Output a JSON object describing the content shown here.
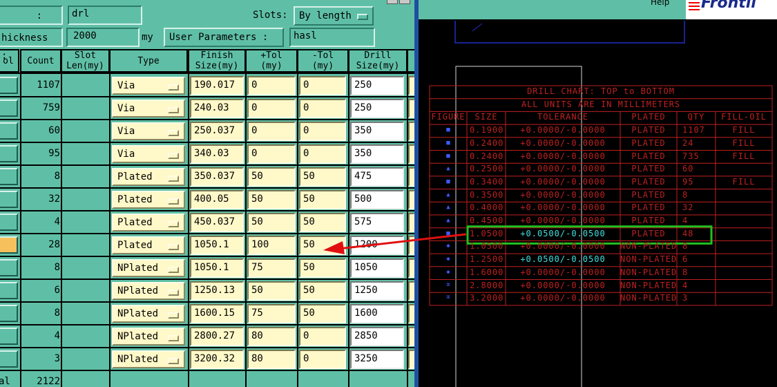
{
  "dialog": {
    "colon_label": ":",
    "name_value": "drl",
    "slots_label": "Slots:",
    "slots_value": "By length",
    "thickness_label": "hickness :",
    "thickness_value": "2000",
    "thickness_unit": "my",
    "user_params_label": "User Parameters :",
    "user_params_value": "hasl",
    "headers": [
      "ol",
      "Count",
      "Slot\nLen(my)",
      "Type",
      "Finish\nSize(my)",
      "+Tol\n(my)",
      "-Tol\n(my)",
      "Drill\nSize(my)"
    ],
    "rows": [
      {
        "count": "1107",
        "type": "Via",
        "finish": "190.017",
        "ptol": "0",
        "ntol": "0",
        "drill": "250"
      },
      {
        "count": "759",
        "type": "Via",
        "finish": "240.03",
        "ptol": "0",
        "ntol": "0",
        "drill": "250"
      },
      {
        "count": "60",
        "type": "Via",
        "finish": "250.037",
        "ptol": "0",
        "ntol": "0",
        "drill": "350"
      },
      {
        "count": "95",
        "type": "Via",
        "finish": "340.03",
        "ptol": "0",
        "ntol": "0",
        "drill": "350"
      },
      {
        "count": "8",
        "type": "Plated",
        "finish": "350.037",
        "ptol": "50",
        "ntol": "50",
        "drill": "475"
      },
      {
        "count": "32",
        "type": "Plated",
        "finish": "400.05",
        "ptol": "50",
        "ntol": "50",
        "drill": "500"
      },
      {
        "count": "4",
        "type": "Plated",
        "finish": "450.037",
        "ptol": "50",
        "ntol": "50",
        "drill": "575"
      },
      {
        "count": "28",
        "type": "Plated",
        "finish": "1050.1",
        "ptol": "100",
        "ntol": "50",
        "drill": "1200",
        "selected": true
      },
      {
        "count": "8",
        "type": "NPlated",
        "finish": "1050.1",
        "ptol": "75",
        "ntol": "50",
        "drill": "1050"
      },
      {
        "count": "6",
        "type": "NPlated",
        "finish": "1250.13",
        "ptol": "50",
        "ntol": "50",
        "drill": "1250"
      },
      {
        "count": "8",
        "type": "NPlated",
        "finish": "1600.15",
        "ptol": "75",
        "ntol": "50",
        "drill": "1600"
      },
      {
        "count": "4",
        "type": "NPlated",
        "finish": "2800.27",
        "ptol": "80",
        "ntol": "0",
        "drill": "2850"
      },
      {
        "count": "3",
        "type": "NPlated",
        "finish": "3200.32",
        "ptol": "80",
        "ntol": "0",
        "drill": "3250"
      }
    ],
    "total_label": "al",
    "total_count": "2122"
  },
  "cad": {
    "help_label": "Help",
    "logo_text": "Frontli",
    "chart_title": "DRILL CHART: TOP to BOTTOM",
    "chart_subtitle": "ALL UNITS ARE IN MILLIMETERS",
    "columns": [
      "FIGURE",
      "SIZE",
      "TOLERANCE",
      "PLATED",
      "QTY",
      "FILL-OIL"
    ],
    "rows": [
      {
        "size": "0.1900",
        "tol": "+0.0000/-0.0000",
        "plated": "PLATED",
        "qty": "1107",
        "fill": "FILL"
      },
      {
        "size": "0.2400",
        "tol": "+0.0000/-0.0000",
        "plated": "PLATED",
        "qty": "24",
        "fill": "FILL"
      },
      {
        "size": "0.2400",
        "tol": "+0.0000/-0.0000",
        "plated": "PLATED",
        "qty": "735",
        "fill": "FILL"
      },
      {
        "size": "0.2500",
        "tol": "+0.0000/-0.0000",
        "plated": "PLATED",
        "qty": "60",
        "fill": ""
      },
      {
        "size": "0.3400",
        "tol": "+0.0000/-0.0000",
        "plated": "PLATED",
        "qty": "95",
        "fill": "FILL"
      },
      {
        "size": "0.3500",
        "tol": "+0.0000/-0.0000",
        "plated": "PLATED",
        "qty": "8",
        "fill": ""
      },
      {
        "size": "0.4000",
        "tol": "+0.0000/-0.0000",
        "plated": "PLATED",
        "qty": "32",
        "fill": ""
      },
      {
        "size": "0.4500",
        "tol": "+0.0000/-0.0000",
        "plated": "PLATED",
        "qty": "4",
        "fill": ""
      },
      {
        "size": "1.0500",
        "tol": "+0.0500/-0.0500",
        "plated": "PLATED",
        "qty": "48",
        "fill": "",
        "highlight": true
      },
      {
        "size": "1.0500",
        "tol": "+0.0000/-0.0000",
        "plated": "NON-PLATED",
        "qty": "8",
        "fill": ""
      },
      {
        "size": "1.2500",
        "tol": "+0.0500/-0.0500",
        "plated": "NON-PLATED",
        "qty": "6",
        "fill": "",
        "tol_cyan": true
      },
      {
        "size": "1.6000",
        "tol": "+0.0000/-0.0000",
        "plated": "NON-PLATED",
        "qty": "8",
        "fill": ""
      },
      {
        "size": "2.8000",
        "tol": "+0.0000/-0.0000",
        "plated": "NON-PLATED",
        "qty": "4",
        "fill": ""
      },
      {
        "size": "3.2000",
        "tol": "+0.0000/-0.0000",
        "plated": "NON-PLATED",
        "qty": "3",
        "fill": ""
      }
    ],
    "figure_glyphs": [
      "■",
      "■",
      "■",
      "▲",
      "■",
      "▲",
      "▲",
      "▲",
      "■",
      "◆",
      "◆",
      "◆",
      "⌘",
      "⌘"
    ],
    "colors": {
      "chart_red": "#c02020",
      "highlight_green": "#20c020",
      "arrow_red": "#e01010",
      "cyan": "#40e0e0",
      "figure_blue": "#3a5cff"
    }
  }
}
